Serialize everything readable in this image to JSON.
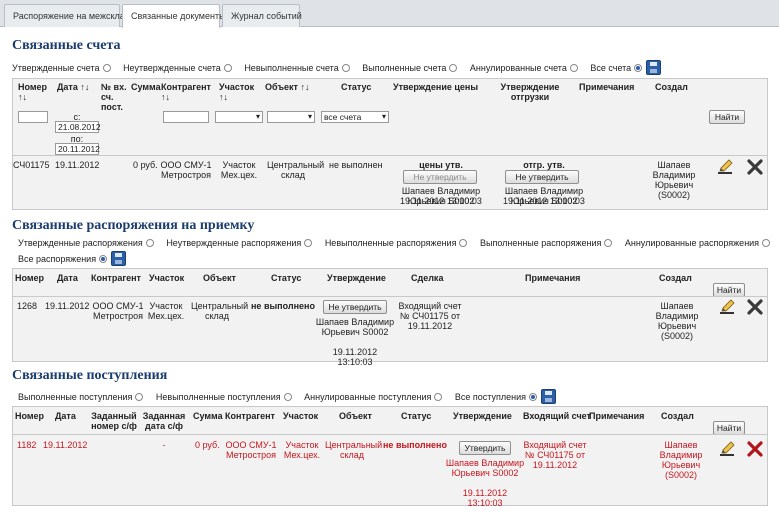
{
  "tabs": [
    "Распоряжение на межсклад",
    "Связанные документы",
    "Журнал событий"
  ],
  "s1": {
    "title": "Связанные счета",
    "filters": [
      "Утвержденные счета",
      "Неутвержденные счета",
      "Невыполненные счета",
      "Выполненные счета",
      "Аннулированные счета",
      "Все счета"
    ],
    "headers": {
      "number": "Номер",
      "date": "Дата",
      "num_inv": "№ вх. сч. пост.",
      "sum": "Сумма",
      "contractor": "Контрагент",
      "area": "Участок",
      "object": "Объект",
      "status": "Статус",
      "price_appr": "Утверждение цены",
      "ship_appr": "Утверждение отгрузки",
      "notes": "Примечания",
      "creator": "Создал"
    },
    "filter_row": {
      "from_label": "с:",
      "from_value": "21.08.2012",
      "to_label": "по:",
      "to_value": "20.11.2012",
      "status_value": "все счета",
      "find": "Найти"
    },
    "row": {
      "number": "СЧ01175",
      "date": "19.11.2012",
      "sum": "0 руб.",
      "contractor": "ООО СМУ-1 Метростроя",
      "area": "Участок Мех.цех.",
      "object": "Центральный склад",
      "status": "не выполнен",
      "price_status": "цены утв.",
      "price_btn": "Не утвердить",
      "price_who": "Шапаев Владимир Юрьевич S0002",
      "price_when": "19.11.2012 13:10:03",
      "ship_status": "отгр. утв.",
      "ship_btn": "Не утвердить",
      "ship_who": "Шапаев Владимир Юрьевич S0002",
      "ship_when": "19.11.2012 13:10:03",
      "creator": "Шапаев Владимир Юрьевич (S0002)"
    }
  },
  "s2": {
    "title": "Связанные распоряжения на приемку",
    "filters": [
      "Утвержденные распоряжения",
      "Неутвержденные распоряжения",
      "Невыполненные распоряжения",
      "Выполненные распоряжения",
      "Аннулированные распоряжения",
      "Все распоряжения"
    ],
    "headers": {
      "number": "Номер",
      "date": "Дата",
      "contractor": "Контрагент",
      "area": "Участок",
      "object": "Объект",
      "status": "Статус",
      "approval": "Утверждение",
      "deal": "Сделка",
      "notes": "Примечания",
      "creator": "Создал"
    },
    "find": "Найти",
    "row": {
      "number": "1268",
      "date": "19.11.2012",
      "contractor": "ООО СМУ-1 Метростроя",
      "area": "Участок Мех.цех.",
      "object": "Центральный склад",
      "status": "не выполнено",
      "btn": "Не утвердить",
      "who": "Шапаев Владимир Юрьевич S0002",
      "when": "19.11.2012 13:10:03",
      "deal": "Входящий счет № СЧ01175 от 19.11.2012",
      "creator": "Шапаев Владимир Юрьевич (S0002)"
    }
  },
  "s3": {
    "title": "Связанные поступления",
    "filters": [
      "Выполненные поступления",
      "Невыполненные поступления",
      "Аннулированные поступления",
      "Все поступления"
    ],
    "headers": {
      "number": "Номер",
      "date": "Дата",
      "set_num": "Заданный номер с/ф",
      "set_date": "Заданная дата с/ф",
      "sum": "Сумма",
      "contractor": "Контрагент",
      "area": "Участок",
      "object": "Объект",
      "status": "Статус",
      "approval": "Утверждение",
      "incoming": "Входящий счет",
      "notes": "Примечания",
      "creator": "Создал"
    },
    "find": "Найти",
    "row": {
      "number": "1182",
      "date": "19.11.2012",
      "set_date": "-",
      "sum": "0 руб.",
      "contractor": "ООО СМУ-1 Метростроя",
      "area": "Участок Мех.цех.",
      "object": "Центральный склад",
      "status": "не выполнено",
      "btn": "Утвердить",
      "who": "Шапаев Владимир Юрьевич S0002",
      "when": "19.11.2012 13:10:03",
      "incoming": "Входящий счет № СЧ01175 от 19.11.2012",
      "creator": "Шапаев Владимир Юрьевич (S0002)"
    }
  },
  "colors": {
    "title": "#1a3c6e",
    "red_row": "#c8161d",
    "panel": "#f2f2f2"
  },
  "icons": [
    "pencil-icon",
    "delete-icon",
    "save-icon",
    "sort-arrows-icon"
  ]
}
